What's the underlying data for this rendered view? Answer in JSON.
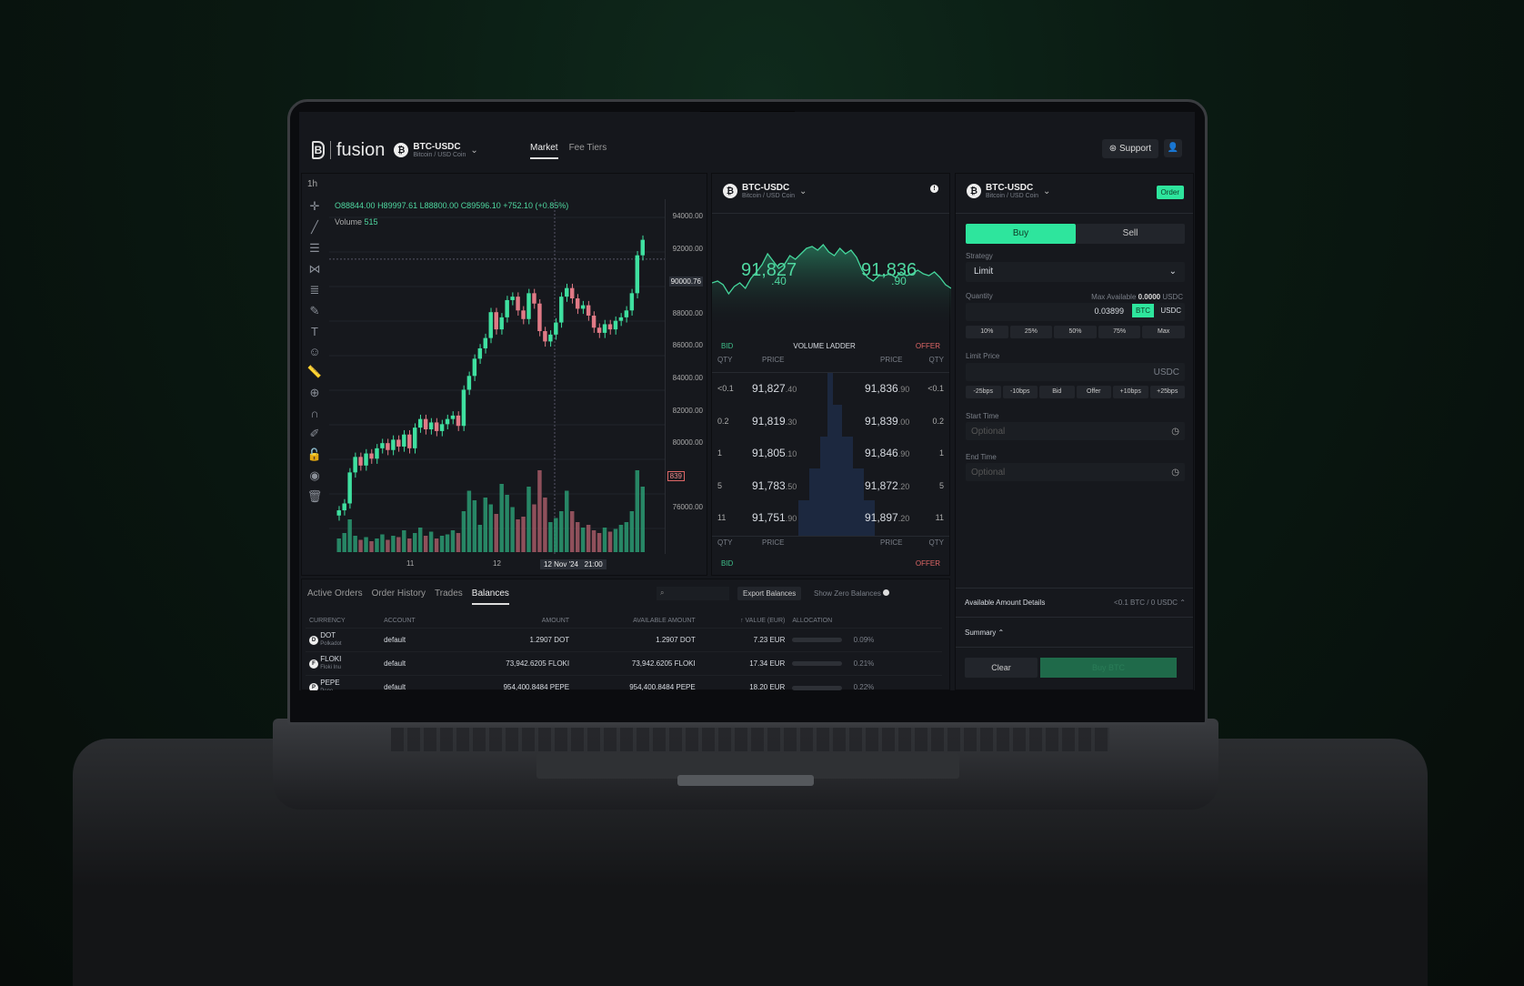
{
  "app": {
    "logo": "fusion",
    "pair": "BTC-USDC",
    "pair_sub": "Bitcoin / USD Coin",
    "nav": [
      {
        "label": "Market",
        "active": true
      },
      {
        "label": "Fee Tiers",
        "active": false
      }
    ],
    "support": "Support",
    "accent": "#2ee59d"
  },
  "chart": {
    "timeframe": "1h",
    "ohlc": {
      "o": "O88844.00",
      "h": "H89997.61",
      "l": "L88800.00",
      "c": "C89596.10",
      "chg": "+752.10 (+0.85%)"
    },
    "volume_label": "Volume",
    "volume_value": "515",
    "price_ticks": [
      "94000.00",
      "92000.00",
      "90000.76",
      "88000.00",
      "86000.00",
      "84000.00",
      "82000.00",
      "80000.00",
      "839",
      "76000.00"
    ],
    "x_ticks": [
      "11",
      "12",
      "12 Nov '24   21:00"
    ],
    "closes": [
      77000,
      77400,
      79200,
      80100,
      79600,
      80300,
      80000,
      80600,
      80900,
      80500,
      81100,
      80700,
      81400,
      80600,
      81800,
      82300,
      81700,
      82100,
      81600,
      82000,
      82300,
      82500,
      81900,
      84000,
      84800,
      85800,
      86400,
      87000,
      88500,
      87500,
      88200,
      89200,
      89400,
      88600,
      88100,
      89600,
      89000,
      87400,
      86800,
      87200,
      87900,
      89400,
      89900,
      89300,
      88700,
      88900,
      88300,
      87600,
      87300,
      87800,
      87500,
      88000,
      88200,
      88600,
      89600,
      91800,
      92700
    ],
    "volumes": [
      10,
      14,
      24,
      12,
      9,
      11,
      8,
      10,
      13,
      9,
      12,
      11,
      16,
      10,
      14,
      18,
      12,
      15,
      10,
      12,
      13,
      16,
      14,
      30,
      45,
      38,
      20,
      40,
      35,
      28,
      50,
      42,
      33,
      24,
      26,
      48,
      35,
      60,
      40,
      22,
      25,
      30,
      45,
      30,
      22,
      18,
      20,
      16,
      14,
      18,
      15,
      17,
      20,
      22,
      30,
      60,
      48
    ]
  },
  "book": {
    "pair": "BTC-USDC",
    "pair_sub": "Bitcoin / USD Coin",
    "bid_big": "91,827",
    "bid_small": ".40",
    "offer_big": "91,836",
    "offer_small": ".90",
    "bid": "BID",
    "offer": "OFFER",
    "ladder": "VOLUME LADDER",
    "qty": "QTY",
    "price": "PRICE",
    "depth": [
      60,
      58,
      62,
      72,
      64,
      60,
      66,
      55,
      48,
      40,
      28,
      36,
      44,
      40,
      30,
      34,
      28,
      22,
      20,
      24,
      18,
      26,
      30,
      22,
      28,
      24,
      32,
      46,
      54,
      58,
      52,
      52,
      50,
      54,
      48,
      52,
      50,
      46,
      50,
      52,
      48,
      54,
      62,
      66
    ],
    "rows": [
      {
        "bq": "<0.1",
        "bp": "91,827",
        "bd": ".40",
        "op": "91,836",
        "od": ".90",
        "oq": "<0.1"
      },
      {
        "bq": "0.2",
        "bp": "91,819",
        "bd": ".30",
        "op": "91,839",
        "od": ".00",
        "oq": "0.2"
      },
      {
        "bq": "1",
        "bp": "91,805",
        "bd": ".10",
        "op": "91,846",
        "od": ".90",
        "oq": "1"
      },
      {
        "bq": "5",
        "bp": "91,783",
        "bd": ".50",
        "op": "91,872",
        "od": ".20",
        "oq": "5"
      },
      {
        "bq": "11",
        "bp": "91,751",
        "bd": ".90",
        "op": "91,897",
        "od": ".20",
        "oq": "11"
      }
    ]
  },
  "order": {
    "pair": "BTC-USDC",
    "pair_sub": "Bitcoin / USD Coin",
    "order_badge": "Order",
    "buy": "Buy",
    "sell": "Sell",
    "strategy_label": "Strategy",
    "strategy": "Limit",
    "quantity_label": "Quantity",
    "max_avail_label": "Max Available",
    "max_avail_value": "0.0000",
    "max_avail_unit": "USDC",
    "quantity": "0.03899",
    "unit_btc": "BTC",
    "unit_usdc": "USDC",
    "pct": [
      "10%",
      "25%",
      "50%",
      "75%",
      "Max"
    ],
    "limit_label": "Limit Price",
    "limit_unit": "USDC",
    "bps": [
      "-25bps",
      "-10bps",
      "Bid",
      "Offer",
      "+10bps",
      "+25bps"
    ],
    "start_label": "Start Time",
    "end_label": "End Time",
    "placeholder": "Optional",
    "avail_details": "Available Amount Details",
    "avail_value": "<0.1 BTC / 0 USDC",
    "summary": "Summary",
    "clear": "Clear",
    "submit": "Buy BTC"
  },
  "balances": {
    "tabs": [
      {
        "label": "Active Orders"
      },
      {
        "label": "Order History"
      },
      {
        "label": "Trades"
      },
      {
        "label": "Balances",
        "active": true
      }
    ],
    "export": "Export Balances",
    "show_zero": "Show Zero Balances",
    "headers": [
      "CURRENCY",
      "ACCOUNT",
      "AMOUNT",
      "AVAILABLE AMOUNT",
      "↑ VALUE (EUR)",
      "ALLOCATION"
    ],
    "rows": [
      {
        "sym": "DOT",
        "name": "Polkadot",
        "account": "default",
        "amount": "1.2907 DOT",
        "avail": "1.2907 DOT",
        "value": "7.23 EUR",
        "alloc": "0.09%",
        "alloc_pct": 0.09
      },
      {
        "sym": "FLOKI",
        "name": "Floki Inu",
        "account": "default",
        "amount": "73,942.6205 FLOKI",
        "avail": "73,942.6205 FLOKI",
        "value": "17.34 EUR",
        "alloc": "0.21%",
        "alloc_pct": 0.21
      },
      {
        "sym": "PEPE",
        "name": "Pepe",
        "account": "default",
        "amount": "954,400.8484 PEPE",
        "avail": "954,400.8484 PEPE",
        "value": "18.20 EUR",
        "alloc": "0.22%",
        "alloc_pct": 0.22
      }
    ]
  }
}
